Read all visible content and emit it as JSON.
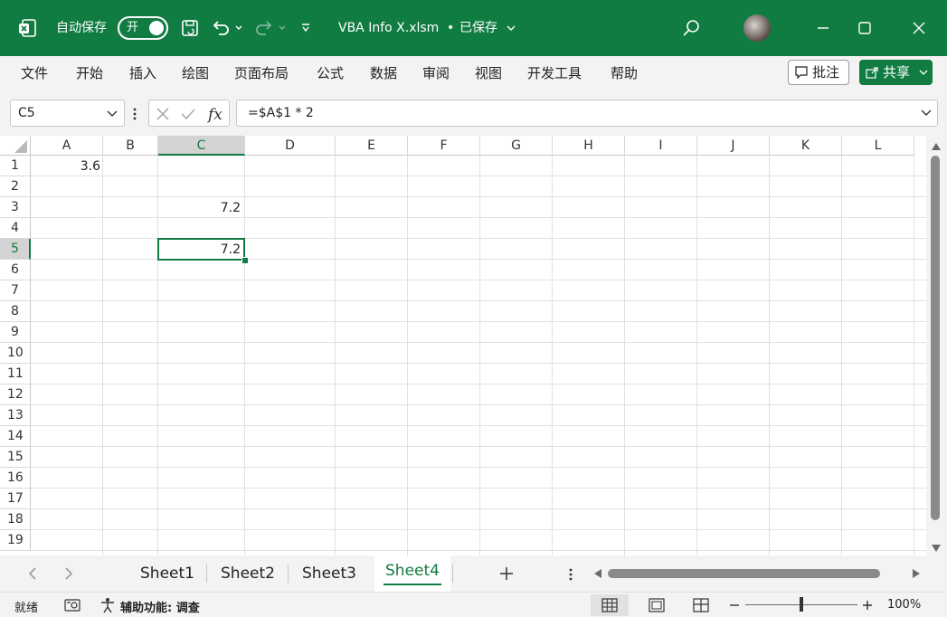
{
  "titlebar": {
    "autosave_label": "自动保存",
    "autosave_state": "开",
    "filename": "VBA Info X.xlsm",
    "save_status": "已保存"
  },
  "ribbon": {
    "tabs": [
      "文件",
      "开始",
      "插入",
      "绘图",
      "页面布局",
      "公式",
      "数据",
      "审阅",
      "视图",
      "开发工具",
      "帮助"
    ],
    "comments_label": "批注",
    "share_label": "共享"
  },
  "formula_bar": {
    "name_box": "C5",
    "formula": "=$A$1 * 2"
  },
  "grid": {
    "columns": [
      "A",
      "B",
      "C",
      "D",
      "E",
      "F",
      "G",
      "H",
      "I",
      "J",
      "K",
      "L"
    ],
    "rows": [
      "1",
      "2",
      "3",
      "4",
      "5",
      "6",
      "7",
      "8",
      "9",
      "10",
      "11",
      "12",
      "13",
      "14",
      "15",
      "16",
      "17",
      "18",
      "19"
    ],
    "selected_cell": "C5",
    "cells": {
      "A1": "3.6",
      "C3": "7.2",
      "C5": "7.2"
    }
  },
  "sheets": {
    "tabs": [
      "Sheet1",
      "Sheet2",
      "Sheet3",
      "Sheet4"
    ],
    "active": "Sheet4"
  },
  "statusbar": {
    "ready": "就绪",
    "accessibility": "辅助功能: 调查",
    "zoom": "100%"
  },
  "colors": {
    "accent": "#107c41"
  }
}
